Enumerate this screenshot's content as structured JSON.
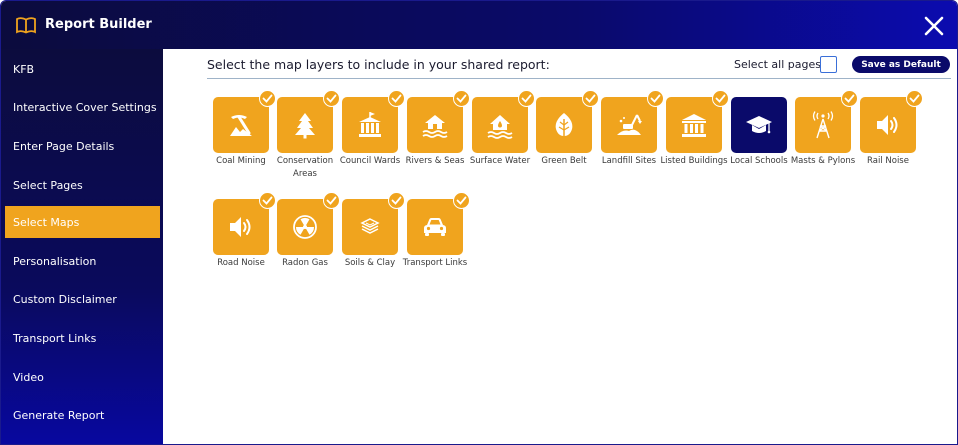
{
  "window": {
    "title": "Report Builder"
  },
  "sidebar": {
    "items": [
      {
        "label": "KFB"
      },
      {
        "label": "Interactive Cover Settings"
      },
      {
        "label": "Enter Page Details"
      },
      {
        "label": "Select Pages"
      },
      {
        "label": "Select Maps",
        "active": true
      },
      {
        "label": "Personalisation"
      },
      {
        "label": "Custom Disclaimer"
      },
      {
        "label": "Transport Links"
      },
      {
        "label": "Video"
      },
      {
        "label": "Generate Report"
      }
    ]
  },
  "main": {
    "heading": "Select the map layers to include in your shared report:",
    "select_all_label": "Select all pages",
    "select_all_checked": false,
    "save_default_label": "Save as Default",
    "layers": [
      {
        "label": "Coal Mining",
        "icon": "pickaxe-icon",
        "selected": true
      },
      {
        "label": "Conservation Areas",
        "icon": "tree-icon",
        "selected": true
      },
      {
        "label": "Council Wards",
        "icon": "town-hall-icon",
        "selected": true
      },
      {
        "label": "Rivers & Seas",
        "icon": "house-flood-icon",
        "selected": true
      },
      {
        "label": "Surface Water",
        "icon": "house-water-icon",
        "selected": true
      },
      {
        "label": "Green Belt",
        "icon": "leaf-icon",
        "selected": true
      },
      {
        "label": "Landfill Sites",
        "icon": "excavator-icon",
        "selected": true
      },
      {
        "label": "Listed Buildings",
        "icon": "columns-building-icon",
        "selected": true
      },
      {
        "label": "Local Schools",
        "icon": "graduation-cap-icon",
        "selected": false
      },
      {
        "label": "Masts & Pylons",
        "icon": "pylon-icon",
        "selected": true
      },
      {
        "label": "Rail Noise",
        "icon": "speaker-icon",
        "selected": true
      },
      {
        "label": "Road Noise",
        "icon": "speaker-icon",
        "selected": true
      },
      {
        "label": "Radon Gas",
        "icon": "radiation-icon",
        "selected": true
      },
      {
        "label": "Soils & Clay",
        "icon": "layers-icon",
        "selected": true
      },
      {
        "label": "Transport Links",
        "icon": "car-icon",
        "selected": true
      }
    ]
  },
  "colors": {
    "accent": "#f0a41e",
    "navy": "#0a0a6a",
    "sidebar_top": "#0c0c3e",
    "sidebar_bottom": "#0808a0"
  }
}
